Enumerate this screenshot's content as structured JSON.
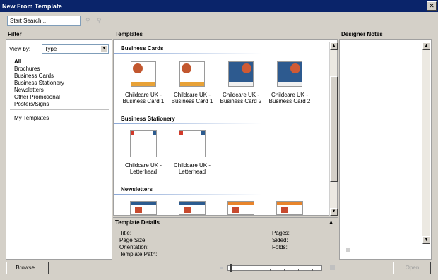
{
  "window": {
    "title": "New From Template"
  },
  "search": {
    "placeholder": "Start Search..."
  },
  "filter": {
    "header": "Filter",
    "view_by_label": "View by:",
    "view_by_value": "Type",
    "items": [
      "All",
      "Brochures",
      "Business Cards",
      "Business Stationery",
      "Newsletters",
      "Other Promotional",
      "Posters/Signs"
    ],
    "my_templates": "My Templates"
  },
  "templates": {
    "header": "Templates",
    "sections": [
      {
        "title": "Business Cards",
        "items": [
          {
            "line1": "Childcare UK -",
            "line2": "Business Card 1"
          },
          {
            "line1": "Childcare UK -",
            "line2": "Business Card 1"
          },
          {
            "line1": "Childcare UK -",
            "line2": "Business Card 2"
          },
          {
            "line1": "Childcare UK -",
            "line2": "Business Card 2"
          }
        ]
      },
      {
        "title": "Business Stationery",
        "items": [
          {
            "line1": "Childcare UK -",
            "line2": "Letterhead"
          },
          {
            "line1": "Childcare UK -",
            "line2": "Letterhead"
          }
        ]
      },
      {
        "title": "Newsletters",
        "items": []
      }
    ]
  },
  "details": {
    "header": "Template Details",
    "title_label": "Title:",
    "page_size_label": "Page Size:",
    "orientation_label": "Orientation:",
    "template_path_label": "Template Path:",
    "pages_label": "Pages:",
    "sided_label": "Sided:",
    "folds_label": "Folds:"
  },
  "notes": {
    "header": "Designer Notes"
  },
  "footer": {
    "browse_label": "Browse...",
    "open_label": "Open"
  },
  "colors": {
    "title_bar": "#0a246a",
    "panel_bg": "#d4d0c8"
  }
}
